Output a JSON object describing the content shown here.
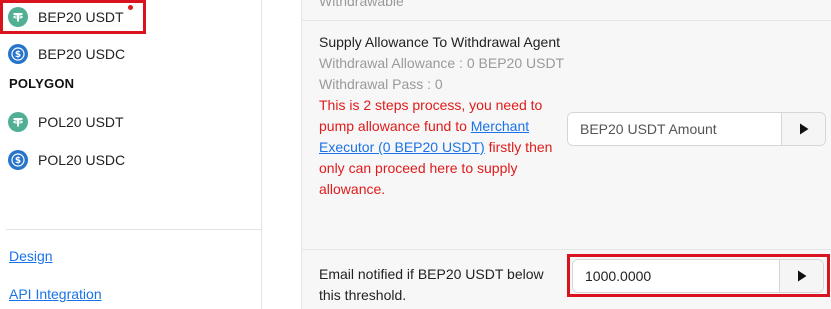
{
  "sidebar": {
    "items": [
      {
        "label": "BEP20 USDT",
        "icon": "tether-icon"
      },
      {
        "label": "BEP20 USDC",
        "icon": "usdc-icon"
      },
      {
        "label": "POL20 USDT",
        "icon": "tether-icon"
      },
      {
        "label": "POL20 USDC",
        "icon": "usdc-icon"
      }
    ],
    "section_title": "POLYGON",
    "links": [
      {
        "label": "Design"
      },
      {
        "label": "API Integration"
      }
    ]
  },
  "main": {
    "top_cut_label": "Withdrawable",
    "allowance": {
      "title": "Supply Allowance To Withdrawal Agent",
      "withdrawal_allowance": "Withdrawal Allowance : 0 BEP20 USDT",
      "withdrawal_pass": "Withdrawal Pass : 0",
      "warning_before": "This is 2 steps process, you need to pump allowance fund to ",
      "warning_link": "Merchant Executor (0 BEP20 USDT)",
      "warning_after": " firstly then only can proceed here to supply allowance.",
      "amount_placeholder": "BEP20 USDT Amount",
      "submit_icon": "play-icon"
    },
    "threshold": {
      "label": "Email notified if BEP20 USDT below this threshold.",
      "value": "1000.0000",
      "submit_icon": "play-icon"
    }
  },
  "colors": {
    "tether": "#50af95",
    "usdc": "#2775ca",
    "highlight": "#d9141e",
    "warning": "#e01b1b",
    "link": "#1a73e8"
  }
}
